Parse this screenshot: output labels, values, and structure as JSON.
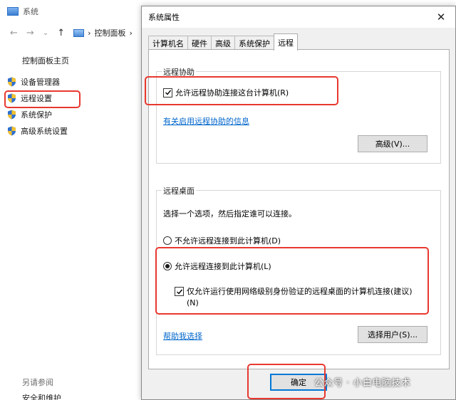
{
  "background": {
    "title": "系统",
    "nav": {
      "back": "←",
      "forward": "→",
      "dropdown": "⌄",
      "up": "↑",
      "sep": "›",
      "crumb": "控制面板",
      "crumb_sep": "›"
    },
    "home_label": "控制面板主页",
    "links": [
      {
        "label": "设备管理器"
      },
      {
        "label": "远程设置"
      },
      {
        "label": "系统保护"
      },
      {
        "label": "高级系统设置"
      }
    ],
    "see_also": "另请参阅",
    "security": "安全和维护"
  },
  "dialog": {
    "title": "系统属性",
    "close": "✕",
    "tabs": [
      {
        "label": "计算机名"
      },
      {
        "label": "硬件"
      },
      {
        "label": "高级"
      },
      {
        "label": "系统保护"
      },
      {
        "label": "远程"
      }
    ],
    "remote_assistance": {
      "group_label": "远程协助",
      "checkbox_label": "允许远程协助连接这台计算机(R)",
      "checked": true,
      "info_link": "有关启用远程协助的信息",
      "advanced_button": "高级(V)..."
    },
    "remote_desktop": {
      "group_label": "远程桌面",
      "instruction": "选择一个选项，然后指定谁可以连接。",
      "option_deny": "不允许远程连接到此计算机(D)",
      "option_allow": "允许远程连接到此计算机(L)",
      "selected": "allow",
      "nla_label_line1": "仅允许运行使用网络级别身份验证的远程桌面的计算机连接(建议)",
      "nla_label_line2": "(N)",
      "nla_checked": true,
      "help_link": "帮助我选择",
      "select_users_button": "选择用户(S)..."
    },
    "ok_button": "确定"
  },
  "watermark": "公众号 · 小白电脑技术",
  "colors": {
    "highlight": "#e8382f",
    "link": "#0066cc",
    "primary_border": "#0078d7"
  }
}
